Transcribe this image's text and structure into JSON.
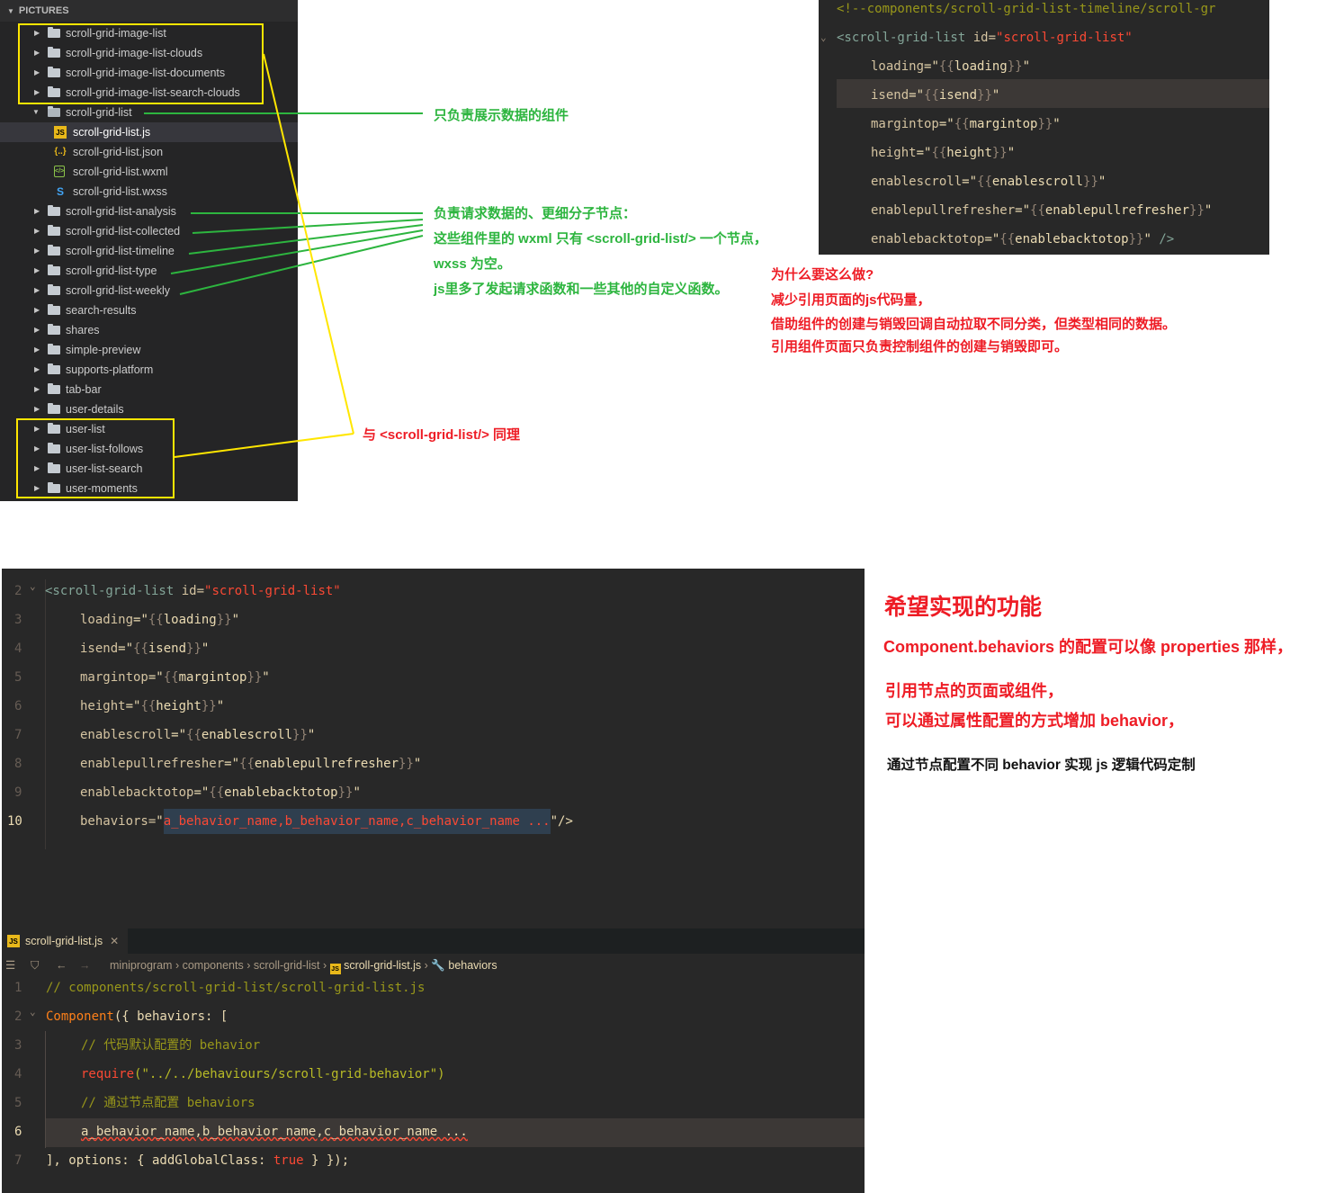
{
  "explorer": {
    "header": "PICTURES",
    "items": [
      {
        "label": "scroll-grid-image-list",
        "kind": "folder"
      },
      {
        "label": "scroll-grid-image-list-clouds",
        "kind": "folder"
      },
      {
        "label": "scroll-grid-image-list-documents",
        "kind": "folder"
      },
      {
        "label": "scroll-grid-image-list-search-clouds",
        "kind": "folder"
      },
      {
        "label": "scroll-grid-list",
        "kind": "folder-open"
      },
      {
        "label": "scroll-grid-list.js",
        "kind": "js"
      },
      {
        "label": "scroll-grid-list.json",
        "kind": "json"
      },
      {
        "label": "scroll-grid-list.wxml",
        "kind": "wxml"
      },
      {
        "label": "scroll-grid-list.wxss",
        "kind": "wxss"
      },
      {
        "label": "scroll-grid-list-analysis",
        "kind": "folder"
      },
      {
        "label": "scroll-grid-list-collected",
        "kind": "folder"
      },
      {
        "label": "scroll-grid-list-timeline",
        "kind": "folder"
      },
      {
        "label": "scroll-grid-list-type",
        "kind": "folder"
      },
      {
        "label": "scroll-grid-list-weekly",
        "kind": "folder"
      },
      {
        "label": "search-results",
        "kind": "folder"
      },
      {
        "label": "shares",
        "kind": "folder"
      },
      {
        "label": "simple-preview",
        "kind": "folder"
      },
      {
        "label": "supports-platform",
        "kind": "folder"
      },
      {
        "label": "tab-bar",
        "kind": "folder"
      },
      {
        "label": "user-details",
        "kind": "folder"
      },
      {
        "label": "user-list",
        "kind": "folder"
      },
      {
        "label": "user-list-follows",
        "kind": "folder"
      },
      {
        "label": "user-list-search",
        "kind": "folder"
      },
      {
        "label": "user-moments",
        "kind": "folder"
      }
    ],
    "icons": {
      "js": "JS",
      "json": "{..}",
      "wxml": "</>",
      "wxss": "S"
    }
  },
  "annotations": {
    "display_only": "只负责展示数据的组件",
    "request_1": "负责请求数据的、更细分子节点：",
    "request_2": "这些组件里的 wxml 只有 <scroll-grid-list/> 一个节点，",
    "request_3": "wxss 为空。",
    "request_4": "js里多了发起请求函数和一些其他的自定义函数。",
    "why_1": "为什么要这么做?",
    "why_2": "减少引用页面的js代码量，",
    "why_3": "借助组件的创建与销毁回调自动拉取不同分类，但类型相同的数据。",
    "why_4": "引用组件页面只负责控制组件的创建与销毁即可。",
    "same": "与 <scroll-grid-list/> 同理",
    "goal_title": "希望实现的功能",
    "goal_1": "Component.behaviors 的配置可以像 properties 那样，",
    "goal_2": "引用节点的页面或组件，",
    "goal_3": "可以通过属性配置的方式增加 behavior，",
    "goal_4": "通过节点配置不同 behavior 实现 js 逻辑代码定制"
  },
  "code_top": {
    "comment": "<!--components/scroll-grid-list-timeline/scroll-gr",
    "tag_open": "<scroll-grid-list",
    "id_attr": " id=",
    "id_val": "\"scroll-grid-list\"",
    "attrs": [
      {
        "name": "loading",
        "value": "loading"
      },
      {
        "name": "isend",
        "value": "isend"
      },
      {
        "name": "margintop",
        "value": "margintop"
      },
      {
        "name": "height",
        "value": "height"
      },
      {
        "name": "enablescroll",
        "value": "enablescroll"
      },
      {
        "name": "enablepullrefresher",
        "value": "enablepullrefresher"
      },
      {
        "name": "enablebacktotop",
        "value": "enablebacktotop"
      }
    ],
    "close": " />"
  },
  "code_bottom_wxml": {
    "line_numbers": [
      "2",
      "3",
      "4",
      "5",
      "6",
      "7",
      "8",
      "9",
      "10"
    ],
    "behaviors_attr": "behaviors=",
    "behaviors_val": "a_behavior_name,b_behavior_name,c_behavior_name ...",
    "behaviors_close": "\"/>"
  },
  "editor": {
    "tab_label": "scroll-grid-list.js",
    "tab_close": "✕",
    "breadcrumb": [
      "miniprogram",
      "components",
      "scroll-grid-list",
      "scroll-grid-list.js",
      "behaviors"
    ],
    "line_numbers": [
      "1",
      "2",
      "3",
      "4",
      "5",
      "6",
      "7"
    ],
    "l1": "// components/scroll-grid-list/scroll-grid-list.js",
    "l2_fn": "Component",
    "l2_rest": "({ behaviors: [",
    "l3": "// 代码默认配置的 behavior",
    "l4_fn": "require",
    "l4_str": "(\"../../behaviours/scroll-grid-behavior\")",
    "l5": "// 通过节点配置 behaviors",
    "l6": "a_behavior_name,b_behavior_name,c_behavior_name ...",
    "l7_a": "], options: { addGlobalClass: ",
    "l7_b": "true",
    "l7_c": " } });"
  }
}
